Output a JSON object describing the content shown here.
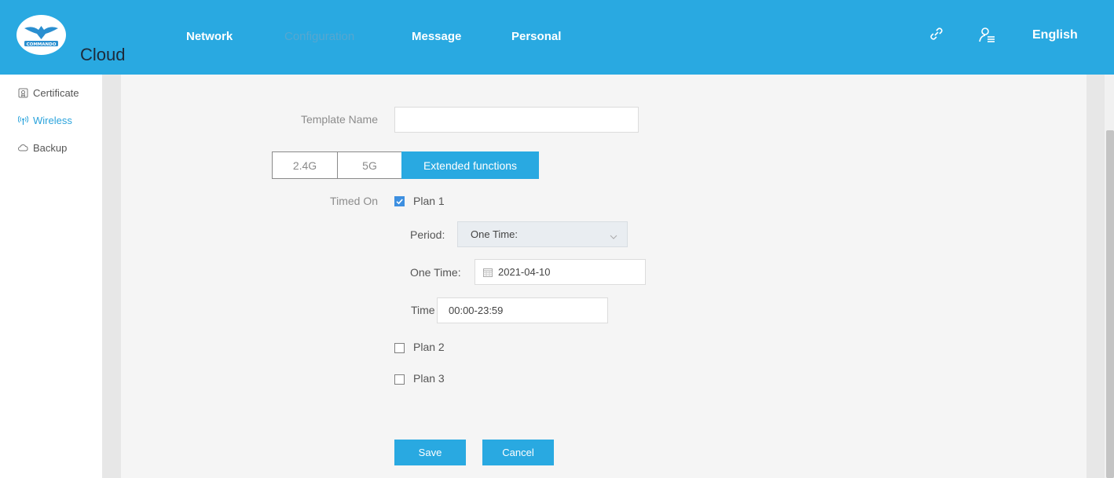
{
  "header": {
    "logo_text": "COMMANDO",
    "brand": "Cloud",
    "nav": [
      "Network",
      "Configuration",
      "Message",
      "Personal"
    ],
    "active_nav": "Configuration",
    "language": "English"
  },
  "sidebar": {
    "items": [
      {
        "label": "Certificate",
        "icon": "certificate-icon"
      },
      {
        "label": "Wireless",
        "icon": "wireless-icon",
        "active": true
      },
      {
        "label": "Backup",
        "icon": "cloud-icon"
      }
    ]
  },
  "form": {
    "template_name_label": "Template Name",
    "template_name_value": "",
    "tabs": [
      "2.4G",
      "5G",
      "Extended functions"
    ],
    "active_tab": "Extended functions",
    "timed_on_label": "Timed On",
    "plans": [
      {
        "label": "Plan 1",
        "checked": true
      },
      {
        "label": "Plan 2",
        "checked": false
      },
      {
        "label": "Plan 3",
        "checked": false
      }
    ],
    "period_label": "Period:",
    "period_value": "One Time:",
    "one_time_label": "One Time:",
    "one_time_value": "2021-04-10",
    "time_label": "Time",
    "time_value": "00:00-23:59",
    "save_label": "Save",
    "cancel_label": "Cancel"
  },
  "colors": {
    "accent": "#29a9e1",
    "checkbox": "#3d8fe0",
    "background": "#f5f5f5"
  }
}
